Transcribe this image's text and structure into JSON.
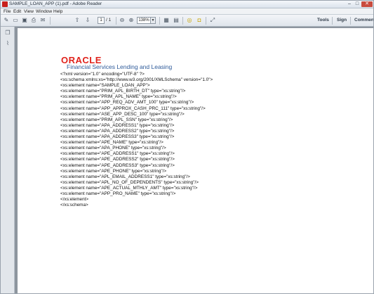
{
  "window": {
    "title": "SAMPLE_LOAN_APP (1).pdf - Adobe Reader"
  },
  "menu": [
    "File",
    "Edit",
    "View",
    "Window",
    "Help"
  ],
  "toolbar": {
    "page_current": "1",
    "page_total": "/ 1",
    "zoom": "138%",
    "right_buttons": {
      "tools": "Tools",
      "sign": "Sign",
      "comment": "Comment"
    }
  },
  "document": {
    "logo": "ORACLE",
    "product": "Financial Services Lending and Leasing",
    "xml_lines": [
      "<?xml version=\"1.0\" encoding=\"UTF-8\" ?>",
      "<xs:schema xmlns:xs=\"http://www.w3.org/2001/XMLSchema\" version=\"1.0\">",
      "<xs:element name=\"SAMPLE_LOAN_APP\">",
      "<xs:element name=\"PRIM_APL_BIRTH_DT\" type=\"xs:string\"/>",
      "<xs:element name=\"PRIM_APL_NAME\" type=\"xs:string\"/>",
      "<xs:element name=\"APP_REQ_ADV_AMT_100\" type=\"xs:string\"/>",
      "<xs:element name=\"APP_APPROX_CASH_PRC_111\" type=\"xs:string\"/>",
      "<xs:element name=\"ASE_APP_DESC_100\" type=\"xs:string\"/>",
      "<xs:element name=\"PRIM_APL_SSN\" type=\"xs:string\"/>",
      "<xs:element name=\"APA_ADDRESS1\" type=\"xs:string\"/>",
      "<xs:element name=\"APA_ADDRESS2\" type=\"xs:string\"/>",
      "<xs:element name=\"APA_ADDRESS3\" type=\"xs:string\"/>",
      "<xs:element name=\"APE_NAME\" type=\"xs:string\"/>",
      "<xs:element name=\"APA_PHONE\" type=\"xs:string\"/>",
      "<xs:element name=\"APE_ADDRESS1\" type=\"xs:string\"/>",
      "<xs:element name=\"APE_ADDRESS2\" type=\"xs:string\"/>",
      "<xs:element name=\"APE_ADDRESS3\" type=\"xs:string\"/>",
      "<xs:element name=\"APE_PHONE\" type=\"xs:string\"/>",
      "<xs:element name=\"APL_EMAIL_ADDRESS1\" type=\"xs:string\"/>",
      "<xs:element name=\"APL_NO_OF_DEPENDENTS\" type=\"xs:string\"/>",
      "<xs:element name=\"APE_ACTUAL_MTHLY_AMT\" type=\"xs:string\"/>",
      "<xs:element name=\"APP_PRO_NAME\" type=\"xs:string\"/>",
      "</xs:element>",
      "</xs:schema>"
    ]
  },
  "colors": {
    "oracle_red": "#e0231c",
    "product_blue": "#2f5b9a",
    "doc_background": "#8d959e"
  },
  "icons": {
    "toolbar": [
      "create-icon",
      "open-icon",
      "save-icon",
      "print-icon",
      "email-icon",
      "prev-page-icon",
      "next-page-icon",
      "zoom-out-icon",
      "zoom-in-icon",
      "fit-page-icon",
      "fit-width-icon",
      "comment-icon",
      "highlight-icon",
      "expand-icon"
    ],
    "nav": [
      "pages-icon",
      "attachments-icon"
    ]
  }
}
